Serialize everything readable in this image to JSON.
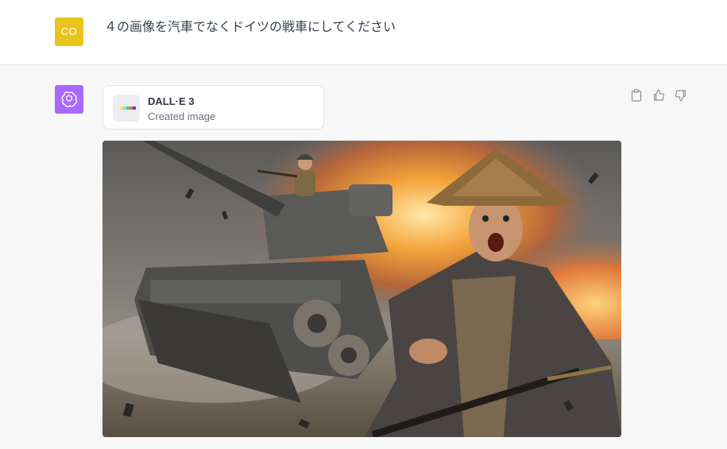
{
  "user_message": {
    "avatar_initials": "CO",
    "avatar_color": "#e8c41c",
    "text": "４の画像を汽車でなくドイツの戦車にしてください"
  },
  "assistant_message": {
    "avatar_icon": "openai-logo-icon",
    "avatar_color": "#ab68ff",
    "tool": {
      "name": "DALL·E 3",
      "status": "Created image"
    },
    "actions": [
      "clipboard-icon",
      "thumbs-up-icon",
      "thumbs-down-icon"
    ],
    "image": {
      "subject": "a German tank with a soldier on top charging toward a frightened samurai in a straw hat, explosions in background"
    }
  }
}
